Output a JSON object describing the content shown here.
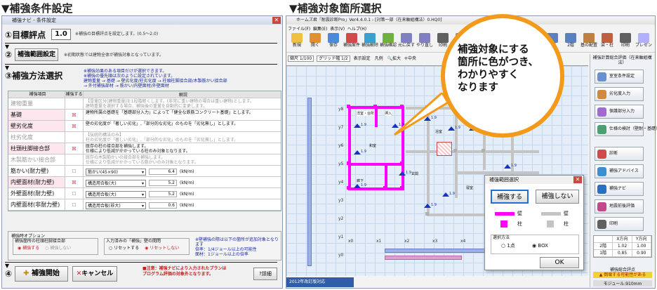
{
  "left": {
    "heading": "▼補強条件設定",
    "window_title": "補強ナビ - 条件設定",
    "step1": {
      "label": "①目標評点",
      "value": "1.0",
      "note": "※補強の目標評点を設定します。(0.5〜2.0)"
    },
    "step2": {
      "label": "②",
      "button": "補強範囲設定",
      "note": "※初期状態では建物全体が補強対象となっています。"
    },
    "step3": {
      "label": "③補強方法選択",
      "notes": [
        "※補強効果のある項目だけが選択できます。",
        "※補強の優先順は次のように設定されています。",
        "建物重量 → 基礎 → 壁劣化度/柱劣化度 → 柱頭柱脚接合部/木製筋かい接合部",
        "→ 外付補強部材 → 筋かい/内壁面材/外壁面材"
      ]
    },
    "table": {
      "headers": [
        "補強項目",
        "補強する",
        "解説"
      ],
      "rows": [
        {
          "item": "建物重量",
          "check": "",
          "desc": [
            "【雪量区分(建物重量)を1段階軽くします。(非常に重い建物の場合は重い建物)とします。",
            "建物重量を選択する場合、補強後の重量を自動的に変更します。"
          ],
          "disabled": true
        },
        {
          "item": "基礎",
          "check": "☒",
          "desc": [
            "建物所属の基礎を「基礎部分入力」によって「健全な鉄筋コンクリート基礎」とします。"
          ],
          "pink": true
        },
        {
          "item": "壁劣化度",
          "check": "☒",
          "desc": [
            "壁の劣化度が「著しい劣化」,「部分的な劣化」のものを「劣化無し」とします。"
          ],
          "pink": true
        },
        {
          "item": "柱劣化度",
          "check": "",
          "desc": [
            "【伝統的構法のみ】",
            "柱の劣化度が「著しい劣化」,「部分的な劣化」のものを「劣化無し」とします。"
          ],
          "disabled": true
        },
        {
          "item": "柱頭柱脚接合部",
          "check": "☒",
          "desc": [
            "既存の柱の接合部を補強します。",
            "仕様により低減がかかっている柱のみ対象となります。"
          ],
          "pink": true
        },
        {
          "item": "木製筋かい接合部",
          "check": "",
          "desc": [
            "既存の木製筋かいの接合部を補強します。",
            "仕様により低減がかかっている筋かいのみ対象となります。"
          ],
          "disabled": true
        },
        {
          "item": "筋かい(耐力壁)",
          "check": "☐",
          "select": "筋かい(45×90)",
          "value": "6.4",
          "unit": "(kN/m)"
        },
        {
          "item": "内壁面材(耐力壁)",
          "check": "☒",
          "select": "構造用合板(大)",
          "value": "5.2",
          "unit": "(kN/m)",
          "pink": true
        },
        {
          "item": "外壁面材(耐力壁)",
          "check": "☐",
          "select": "構造用合板(大)",
          "value": "5.2",
          "unit": "(kN/m)"
        },
        {
          "item": "内壁面材(非耐力壁)",
          "check": "☐",
          "select": "構造用合板(非大)",
          "value": "0.6",
          "unit": "(kN/m)"
        }
      ]
    },
    "options": {
      "title": "補強時オプション",
      "group1_title": "補強箇所の柱頭柱脚接合部",
      "group1": [
        "補強する",
        "補強しない"
      ],
      "group2_title": "入力済みの「補強」壁の開閉",
      "group2": [
        "リセットする",
        "リセットしない"
      ],
      "note": [
        "※壁補強の際は以下の箇所が追加対象となります",
        "倍率：1/4ジョール以上の可能性",
        "面材：1ジョール以上の倍率"
      ]
    },
    "step4": {
      "label": "④",
      "start": "補強開始",
      "cancel": "キャンセル",
      "warning": [
        "■注意：補強ナビにより入力されたプランは",
        "プログラム評価の対象外となります。"
      ],
      "help": "詳細"
    }
  },
  "right": {
    "heading": "▼補強対象箇所選択",
    "window_title": "ホームズ君「耐震診断Pro」Ver4.4.0.1 - [対策一部（在来軸組構法）0.HQ0]",
    "menu": [
      "ファイル(F)",
      "編集(E)",
      "表示(V)",
      "ヘルプ(H)"
    ],
    "toolbar": [
      "新規",
      "開く",
      "保存",
      "補強案件",
      "補強解除",
      "補強確認",
      "元に戻す",
      "やり直し",
      "印刷",
      "メニュー"
    ],
    "toolbar_right": [
      "3D表示",
      "1階",
      "2階",
      "基の配置",
      "梁・柱",
      "印刷",
      "プレゼン"
    ],
    "toolbar2": [
      "縮尺 1/100",
      "グリッド幅 1/2",
      "表示設定",
      "凡例",
      "拡大",
      "中央",
      "縮小"
    ],
    "rooms": [
      "洋室・台所",
      "押入",
      "和室",
      "廊下",
      "玄関",
      "浴室",
      "洗面",
      "寝室",
      "トイレ"
    ],
    "axis_y": [
      "y8",
      "y7",
      "y6",
      "y5",
      "y4",
      "y3",
      "y2",
      "y1",
      "y0"
    ],
    "axis_x": [
      "x0",
      "x1",
      "x2",
      "x3",
      "x4",
      "x5",
      "x6",
      "x7",
      "x8"
    ],
    "wall_value": "1.9",
    "status": "2012年改訂版対応",
    "callout": [
      "補強対象にする",
      "箇所に色がつき、",
      "わかりやすく",
      "なります"
    ],
    "dialog": {
      "title": "補強範囲選択",
      "btn_reinforce": "補強する",
      "btn_no": "補強しない",
      "wall": "壁",
      "column": "柱",
      "method_title": "選択方法",
      "method_options": [
        "1点",
        "BOX"
      ],
      "ok": "OK"
    },
    "sidebar": {
      "title": "補強計算総合評価（在来軸組構法）",
      "buttons": [
        "室室条件設定",
        "劣化度入力",
        "保護部分入力",
        "仕様の検討（壁耐・基礎）",
        "診断",
        "補強アドバイス",
        "補強ナビ",
        "地震前後評価",
        "印刷"
      ],
      "table_headers": [
        "",
        "X方向",
        "Y方向"
      ],
      "table_rows": [
        [
          "2階",
          "1.02",
          "1.00"
        ],
        [
          "1階",
          "0.85",
          "0.90"
        ]
      ],
      "result": "補強総合評点",
      "warning": "▲ 倒壊する可能性がある",
      "footer": "モジュール:910mm"
    }
  }
}
